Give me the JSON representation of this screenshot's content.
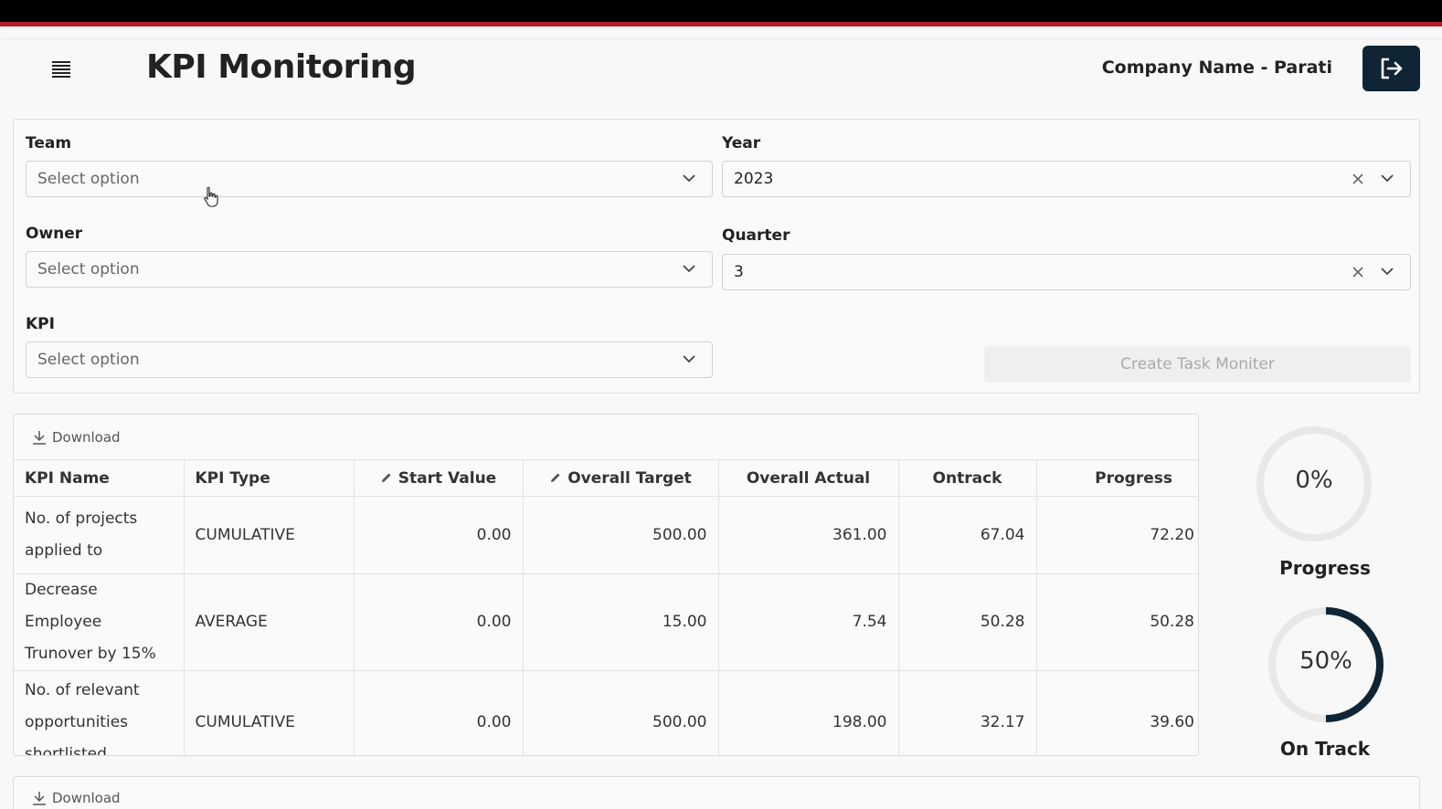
{
  "header": {
    "title": "KPI Monitoring",
    "company": "Company Name - Parati"
  },
  "filters": {
    "team": {
      "label": "Team",
      "placeholder": "Select option"
    },
    "year": {
      "label": "Year",
      "value": "2023"
    },
    "owner": {
      "label": "Owner",
      "placeholder": "Select option"
    },
    "quarter": {
      "label": "Quarter",
      "value": "3"
    },
    "kpi": {
      "label": "KPI",
      "placeholder": "Select option"
    },
    "create_button": "Create Task Moniter"
  },
  "table": {
    "download_label": "Download",
    "columns": [
      "KPI Name",
      "KPI Type",
      "Start Value",
      "Overall Target",
      "Overall Actual",
      "Ontrack",
      "Progress"
    ],
    "rows": [
      {
        "name": "No. of projects applied to",
        "type": "CUMULATIVE",
        "start": "0.00",
        "target": "500.00",
        "actual": "361.00",
        "ontrack": "67.04",
        "progress": "72.20"
      },
      {
        "name": "Decrease Employee Trunover by 15%",
        "type": "AVERAGE",
        "start": "0.00",
        "target": "15.00",
        "actual": "7.54",
        "ontrack": "50.28",
        "progress": "50.28"
      },
      {
        "name": "No. of relevant opportunities shortlisted",
        "type": "CUMULATIVE",
        "start": "0.00",
        "target": "500.00",
        "actual": "198.00",
        "ontrack": "32.17",
        "progress": "39.60"
      }
    ]
  },
  "gauges": {
    "progress": {
      "text": "0%",
      "value": 0,
      "label": "Progress"
    },
    "ontrack": {
      "text": "50%",
      "value": 50,
      "label": "On Track"
    }
  },
  "bottom": {
    "download_label": "Download"
  },
  "colors": {
    "accent": "#0f2535",
    "top_bar": "#000000",
    "top_stripe": "#b01e2a"
  }
}
